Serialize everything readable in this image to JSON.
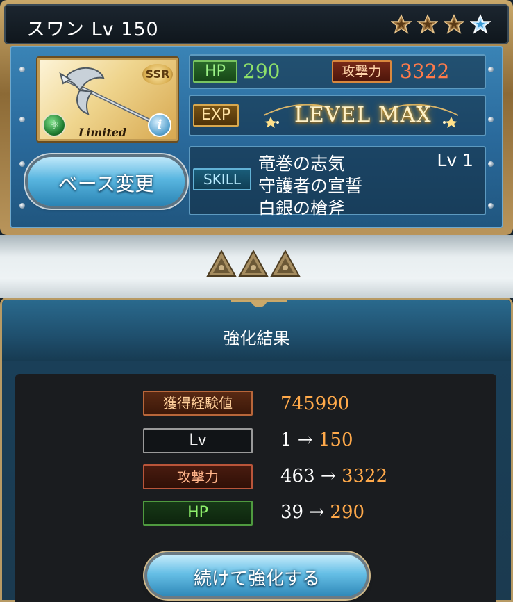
{
  "weapon": {
    "title": "スワン Lv 150",
    "rarity": "SSR",
    "limited_label": "Limited",
    "element_icon": "wind-element-icon",
    "stars": [
      {
        "type": "bronze",
        "filled": true
      },
      {
        "type": "bronze",
        "filled": true
      },
      {
        "type": "bronze",
        "filled": true
      },
      {
        "type": "blue",
        "filled": true
      }
    ]
  },
  "buttons": {
    "base_change": "ベース変更",
    "continue_upgrade": "続けて強化する"
  },
  "stats": {
    "hp_label": "HP",
    "hp_value": "290",
    "atk_label": "攻撃力",
    "atk_value": "3322",
    "exp_label": "EXP",
    "exp_value": "LEVEL MAX",
    "skill_label": "SKILL",
    "skills": [
      "竜巻の志気",
      "守護者の宣誓",
      "白銀の槍斧"
    ],
    "skill_level": "Lv 1"
  },
  "result": {
    "title": "強化結果",
    "gained_exp_label": "獲得経験値",
    "gained_exp_value": "745990",
    "lv_label": "Lv",
    "lv_from": "1 →",
    "lv_to": "150",
    "atk_label": "攻撃力",
    "atk_from": "463 →",
    "atk_to": "3322",
    "hp_label": "HP",
    "hp_from": "39 →",
    "hp_to": "290"
  },
  "colors": {
    "accent_blue": "#2a6a9c",
    "gold_frame": "#b9955b",
    "hp_green": "#8ee06a",
    "atk_red": "#ff7b4a",
    "result_orange": "#ffa94a"
  }
}
